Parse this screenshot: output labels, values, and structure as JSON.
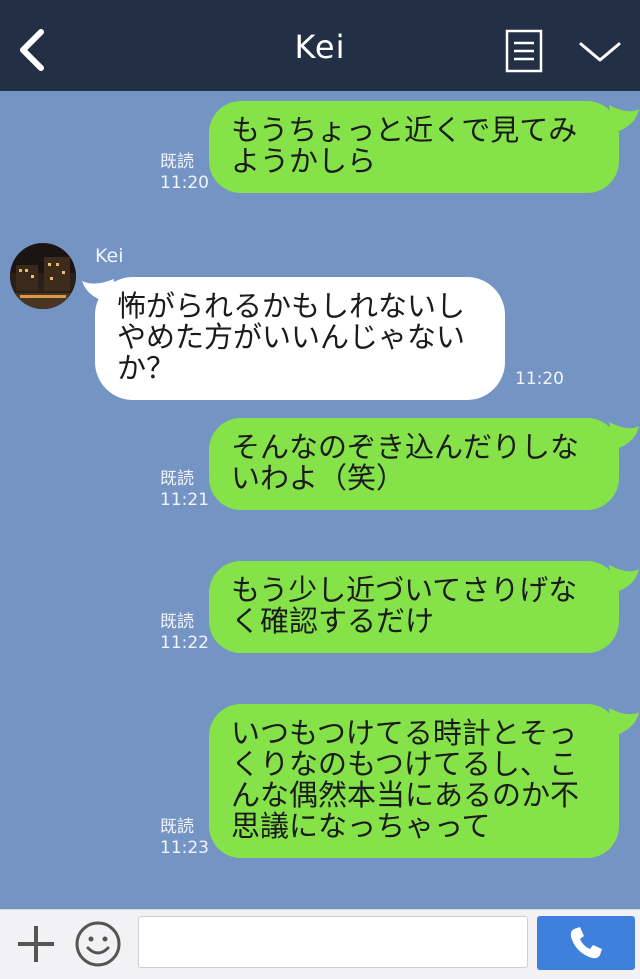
{
  "header": {
    "title": "Kei",
    "back_icon": "chevron-left-icon",
    "notes_icon": "note-icon",
    "menu_icon": "chevron-down-icon"
  },
  "colors": {
    "header_bg": "#232f45",
    "chat_bg": "#7494c4",
    "my_bubble": "#85e249",
    "their_bubble": "#ffffff",
    "call_button": "#3e80dc"
  },
  "messages": [
    {
      "from": "me",
      "text": "もうちょっと近くで見てみ\nようかしら",
      "read": "既読",
      "time": "11:20"
    },
    {
      "from": "Kei",
      "sender": "Kei",
      "text": "怖がられるかもしれないし\nやめた方がいいんじゃない\nか？",
      "time": "11:20"
    },
    {
      "from": "me",
      "text": "そんなのぞき込んだりしな\nいわよ（笑）",
      "read": "既読",
      "time": "11:21"
    },
    {
      "from": "me",
      "text": "もう少し近づいてさりげな\nく確認するだけ",
      "read": "既読",
      "time": "11:22"
    },
    {
      "from": "me",
      "text": "いつもつけてる時計とそっ\nくりなのもつけてるし、こ\nんな偶然本当にあるのか不\n思議になっちゃって",
      "read": "既読",
      "time": "11:23"
    }
  ],
  "footer": {
    "input_value": "",
    "plus_icon": "plus-icon",
    "emoji_icon": "smiley-icon",
    "call_icon": "phone-icon"
  }
}
